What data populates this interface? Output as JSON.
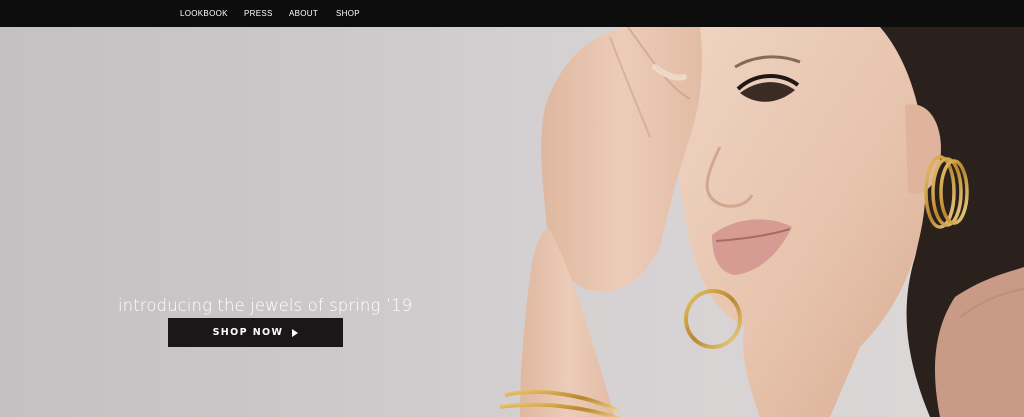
{
  "nav": {
    "items": [
      {
        "label": "LOOKBOOK"
      },
      {
        "label": "PRESS"
      },
      {
        "label": "ABOUT"
      },
      {
        "label": "SHOP"
      }
    ]
  },
  "hero": {
    "headline": "introducing the jewels of spring ’19",
    "cta_label": "SHOP NOW",
    "cta_icon": "chevron-right-icon"
  },
  "colors": {
    "nav_background": "#0d0d0d",
    "cta_background": "#1a1718",
    "hero_background": "#cfcbcc",
    "text": "#ffffff",
    "gold": "#c9a24a"
  }
}
